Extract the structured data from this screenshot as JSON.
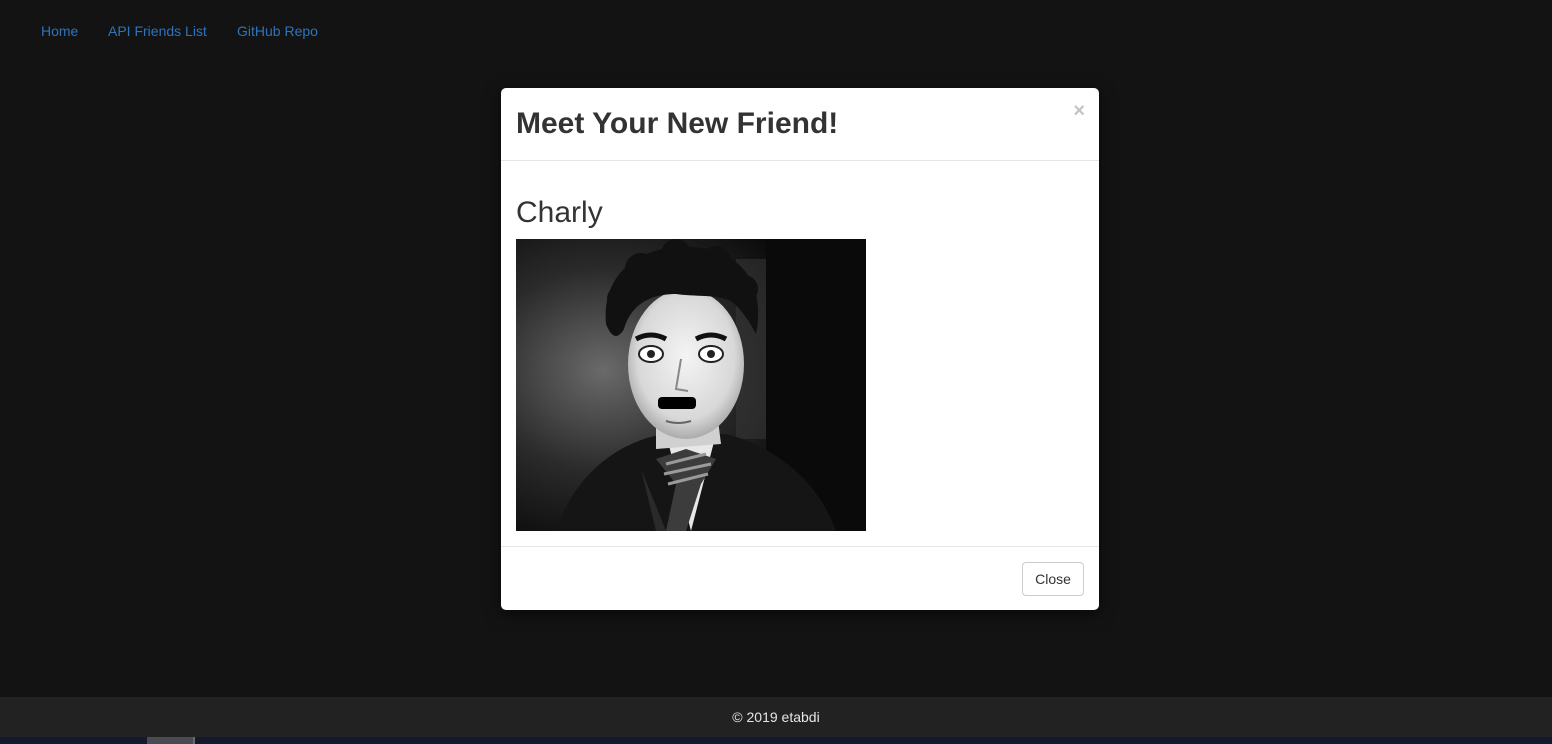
{
  "nav": {
    "home": "Home",
    "api_friends_list": "API Friends List",
    "github_repo": "GitHub Repo"
  },
  "modal": {
    "title": "Meet Your New Friend!",
    "close_symbol": "×",
    "friend_name": "Charly",
    "photo_icon": "portrait-photo-bw",
    "close_button_label": "Close"
  },
  "footer": {
    "text": "© 2019 etabdi"
  },
  "colors": {
    "background": "#131313",
    "link": "#2f73bd",
    "footer_bg": "#222222",
    "modal_bg": "#ffffff"
  }
}
